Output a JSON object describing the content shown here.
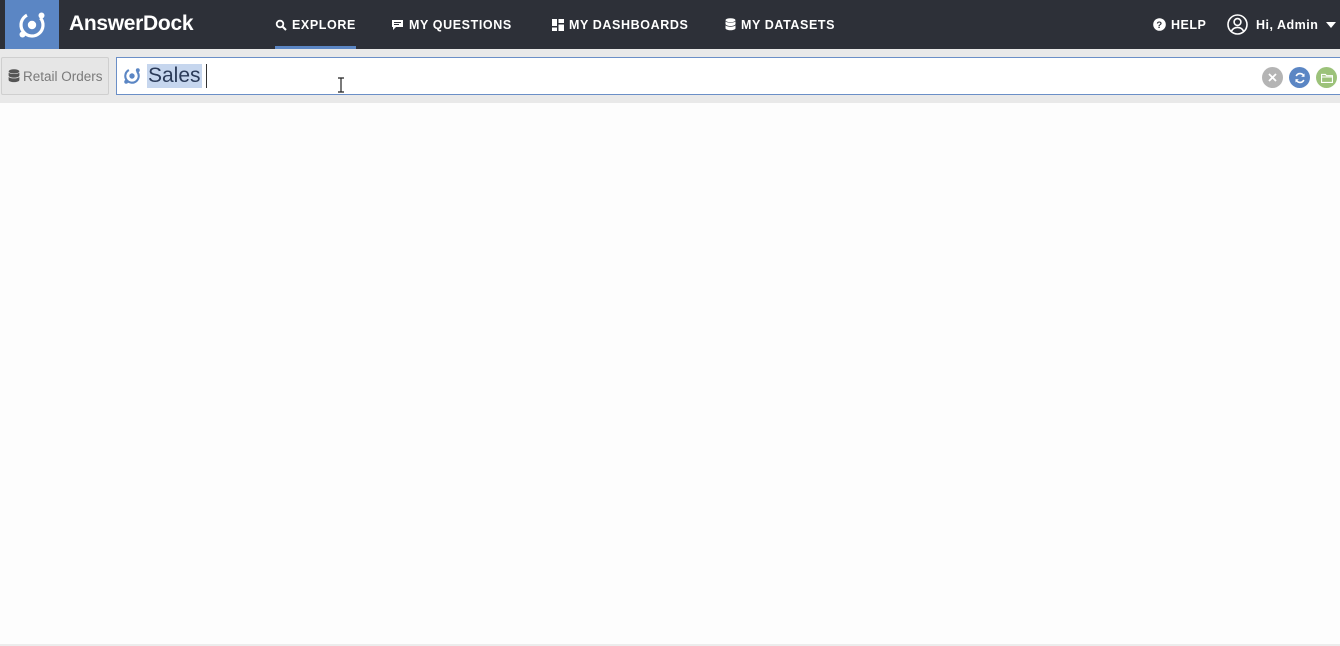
{
  "app": {
    "brand": "AnswerDock"
  },
  "nav": [
    {
      "label": "EXPLORE",
      "icon": "search-icon",
      "active": true
    },
    {
      "label": "MY QUESTIONS",
      "icon": "chat-icon",
      "active": false
    },
    {
      "label": "MY DASHBOARDS",
      "icon": "dashboard-icon",
      "active": false
    },
    {
      "label": "MY DATASETS",
      "icon": "database-icon",
      "active": false
    }
  ],
  "header_right": {
    "help_label": "HELP",
    "user_label": "Hi, Admin"
  },
  "dataset": {
    "label": "Retail Orders",
    "icon": "database-icon"
  },
  "search": {
    "value": "Sales"
  },
  "colors": {
    "topbar": "#2d3038",
    "accent": "#5b86c4",
    "clear": "#b4b4b4",
    "folder": "#9cc27a"
  }
}
